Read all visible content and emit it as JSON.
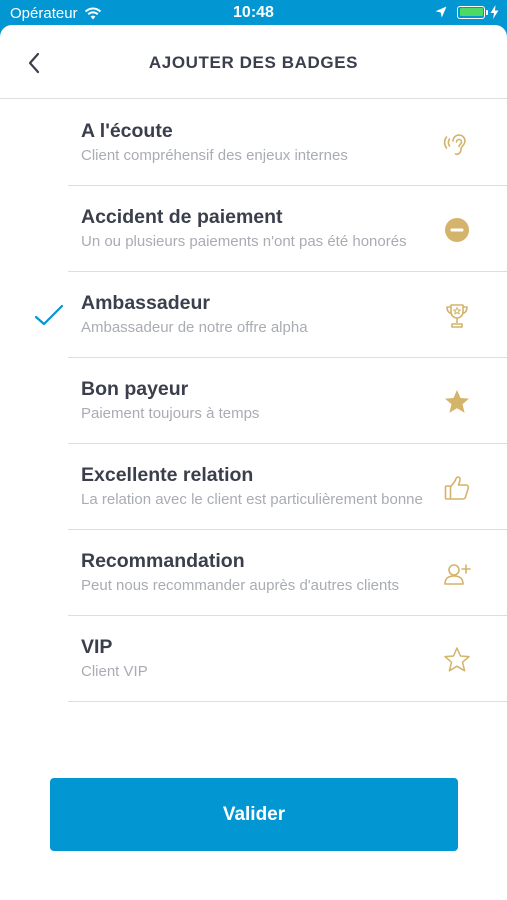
{
  "status_bar": {
    "carrier": "Opérateur",
    "time": "10:48"
  },
  "header": {
    "title": "AJOUTER DES BADGES"
  },
  "colors": {
    "accent": "#0296d3",
    "icon_gold": "#d4b36a",
    "title_text": "#3a3f4b",
    "subtitle_text": "#a9acb3"
  },
  "badges": [
    {
      "title": "A l'écoute",
      "subtitle": "Client compréhensif des enjeux internes",
      "icon": "ear-icon",
      "selected": false
    },
    {
      "title": "Accident de paiement",
      "subtitle": "Un ou plusieurs paiements n'ont pas été honorés",
      "icon": "minus-circle-icon",
      "selected": false
    },
    {
      "title": "Ambassadeur",
      "subtitle": "Ambassadeur de notre offre alpha",
      "icon": "trophy-icon",
      "selected": true
    },
    {
      "title": "Bon payeur",
      "subtitle": "Paiement toujours à temps",
      "icon": "star-filled-icon",
      "selected": false
    },
    {
      "title": "Excellente relation",
      "subtitle": "La relation avec le client est particulièrement bonne",
      "icon": "thumbs-up-icon",
      "selected": false
    },
    {
      "title": "Recommandation",
      "subtitle": "Peut nous recommander auprès d'autres clients",
      "icon": "add-user-icon",
      "selected": false
    },
    {
      "title": "VIP",
      "subtitle": "Client VIP",
      "icon": "star-outline-icon",
      "selected": false
    }
  ],
  "footer": {
    "validate_label": "Valider"
  }
}
